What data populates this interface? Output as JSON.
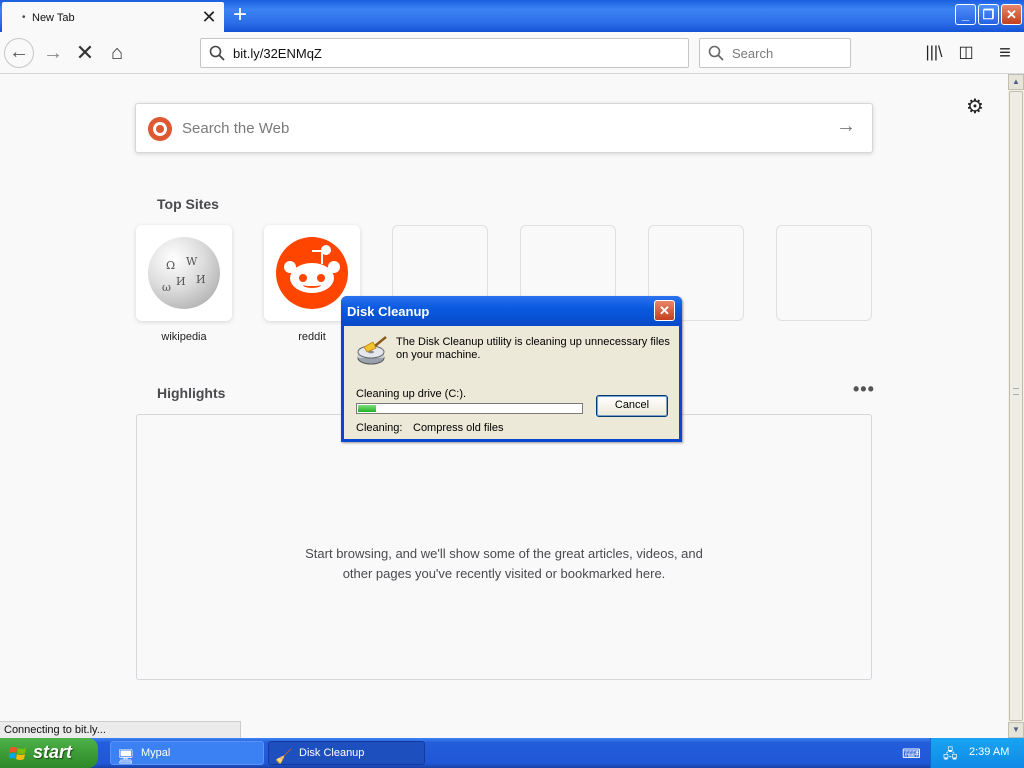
{
  "browser": {
    "tab": {
      "title": "New Tab",
      "dot": "•",
      "close_glyph": "✕"
    },
    "new_tab_glyph": "+",
    "window_controls": {
      "minimize": "_",
      "restore": "❐",
      "close": "✕"
    },
    "nav": {
      "back": "←",
      "forward": "→",
      "stop": "✕",
      "home": "⌂"
    },
    "url": "bit.ly/32ENMqZ",
    "search_placeholder": "Search",
    "tools": {
      "library": "|||\\",
      "sidebar": "◫",
      "menu": "≡"
    },
    "status": "Connecting to bit.ly..."
  },
  "newtab": {
    "settings_glyph": "⚙",
    "web_search": {
      "placeholder": "Search the Web",
      "go_glyph": "→"
    },
    "top_sites_title": "Top Sites",
    "top_sites": [
      {
        "label": "wikipedia",
        "icon": "wikipedia-icon"
      },
      {
        "label": "reddit",
        "icon": "reddit-icon"
      },
      {
        "label": ""
      },
      {
        "label": ""
      },
      {
        "label": ""
      },
      {
        "label": ""
      }
    ],
    "highlights_title": "Highlights",
    "highlights_menu": "•••",
    "highlights_message": "Start browsing, and we'll show some of the great articles, videos, and other pages you've recently visited or bookmarked here."
  },
  "dialog": {
    "title": "Disk Cleanup",
    "close_glyph": "✕",
    "message": "The Disk Cleanup utility is cleaning up unnecessary files on your machine.",
    "drive_text": "Cleaning up drive  (C:).",
    "progress": 0.08,
    "cancel_label": "Cancel",
    "cleaning_label": "Cleaning:",
    "cleaning_value": "Compress old files"
  },
  "taskbar": {
    "start_label": "start",
    "tasks": [
      {
        "label": "Mypal",
        "active": false
      },
      {
        "label": "Disk Cleanup",
        "active": true
      }
    ],
    "clock": "2:39 AM"
  },
  "colors": {
    "xp_blue": "#245edb",
    "start_green": "#3c9c36",
    "progress_green": "#22b122",
    "reddit_orange": "#ff4500",
    "ddg_orange": "#de5833"
  }
}
